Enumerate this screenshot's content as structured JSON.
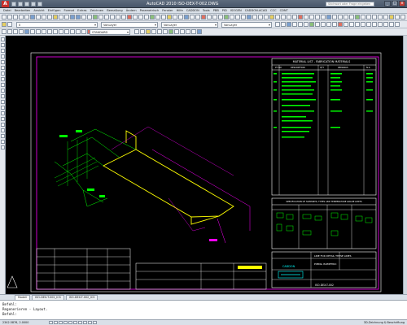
{
  "titlebar": {
    "app_icon": "A",
    "title": "AutoCAD 2010   ISO-DEX-T-002.DWG",
    "search_placeholder": "Stichwort oder Frage eingeben"
  },
  "menu": [
    "Datei",
    "Bearbeiten",
    "Ansicht",
    "Einfügen",
    "Format",
    "Extras",
    "Zeichnen",
    "Bemaßung",
    "Ändern",
    "Parametrisch",
    "Fenster",
    "Hilfe",
    "CADDON",
    "Tools",
    "PBB",
    "PID",
    "ISOGEN",
    "CADDON-ACAD",
    "CCC",
    "CDNT"
  ],
  "toolbar": {
    "layer_combo": "0",
    "color_combo": "VonLayer",
    "linetype_combo": "VonLayer",
    "lineweight_combo": "VonLayer",
    "style_combo": "STANDARD"
  },
  "drawing": {
    "table_title": "MATERIAL LIST - FABRICATION MATERIALS",
    "table_headers": [
      "PT NO",
      "DESCRIPTION",
      "QTY",
      "REMARKS",
      "N.S."
    ],
    "specs_title": "SPECIFICATION OF SUPPORTS, TYPES AND TEMPERATURE GRADE LIMITS",
    "title_block_name": "CADDON",
    "title_block_line1": "LINE FOR DETAIL THESE LINES",
    "title_block_line2": "PIPING ISOMETRIC",
    "drawing_no": "ISO-DEX-T-002"
  },
  "layout_tabs": [
    "Modell",
    "ISO-DEX-T-002_ICS",
    "ISO-DEX-T-002_ICS"
  ],
  "command": {
    "line1": "Befehl:",
    "line2": "Regenerieren - Layout.",
    "line3": "Befehl:"
  },
  "status": {
    "coords": "2342.5876, 2.0000",
    "right": "3D-Zeichnung & Beschriftung"
  },
  "colors": {
    "canvas": "#000000",
    "border": "#ff00ff",
    "pipe": "#ffff00",
    "annotation": "#00ff00",
    "dim": "#00ffff"
  }
}
